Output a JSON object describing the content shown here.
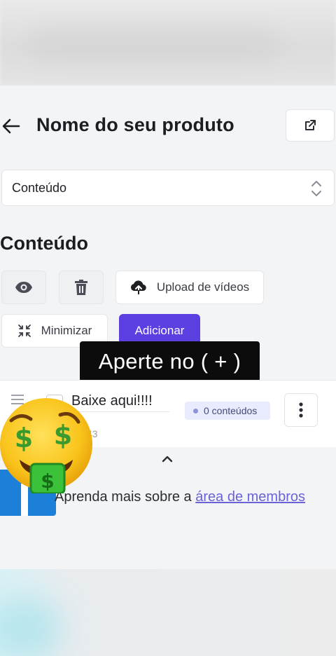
{
  "header": {
    "title": "Nome do seu produto"
  },
  "select": {
    "value": "Conteúdo"
  },
  "section": {
    "title": "Conteúdo"
  },
  "toolbar": {
    "upload_label": "Upload de vídeos",
    "minimize_label": "Minimizar",
    "add_label": "Adicionar"
  },
  "caption": {
    "text": "Aperte no ( + )"
  },
  "module": {
    "name": "Baixe aqui!!!!",
    "badge": "0 conteúdos",
    "date_fragment": "43"
  },
  "footer": {
    "learn_prefix": "Aprenda mais sobre a ",
    "learn_link": "área de membros"
  },
  "colors": {
    "accent": "#5b3fe0",
    "badge_bg": "#e9ecff",
    "link": "#6b62d8"
  },
  "icons": [
    "arrow-left-icon",
    "external-link-icon",
    "sort-arrows-icon",
    "eye-icon",
    "trash-icon",
    "cloud-upload-icon",
    "minimize-icon",
    "drag-handle-icon",
    "kebab-menu-icon",
    "chevron-up-icon",
    "money-mouth-face-emoji"
  ]
}
